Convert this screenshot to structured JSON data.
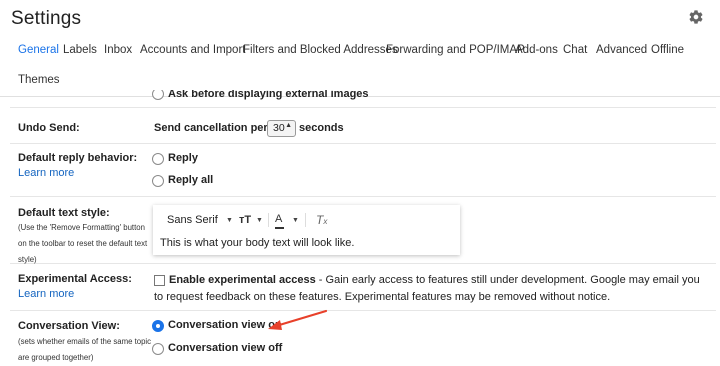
{
  "header": {
    "title": "Settings",
    "settings_icon": "gear-icon"
  },
  "tabs": [
    {
      "label": "General",
      "active": true
    },
    {
      "label": "Labels"
    },
    {
      "label": "Inbox"
    },
    {
      "label": "Accounts and Import"
    },
    {
      "label": "Filters and Blocked Addresses"
    },
    {
      "label": "Forwarding and POP/IMAP"
    },
    {
      "label": "Add-ons"
    },
    {
      "label": "Chat"
    },
    {
      "label": "Advanced"
    },
    {
      "label": "Offline"
    },
    {
      "label": "Themes"
    }
  ],
  "images_row": {
    "option": "Ask before displaying external images"
  },
  "undo_send": {
    "label": "Undo Send:",
    "period_label": "Send cancellation period:",
    "period_value": "30",
    "period_unit": "seconds"
  },
  "reply": {
    "label": "Default reply behavior:",
    "learn_more": "Learn more",
    "options": [
      "Reply",
      "Reply all"
    ]
  },
  "text_style": {
    "label": "Default text style:",
    "hint": "(Use the 'Remove Formatting' button on the toolbar to reset the default text style)",
    "font": "Sans Serif",
    "sample": "This is what your body text will look like."
  },
  "experimental": {
    "label": "Experimental Access:",
    "learn_more": "Learn more",
    "option_bold": "Enable experimental access",
    "description": " - Gain early access to features still under development. Google may email you to request feedback on these features. Experimental features may be removed without notice."
  },
  "conversation": {
    "label": "Conversation View:",
    "hint": "(sets whether emails of the same topic are grouped together)",
    "options": [
      "Conversation view on",
      "Conversation view off"
    ],
    "selected": 0
  },
  "colors": {
    "accent": "#1a73e8",
    "link": "#1565c0",
    "annotation_arrow": "#e8402a"
  }
}
